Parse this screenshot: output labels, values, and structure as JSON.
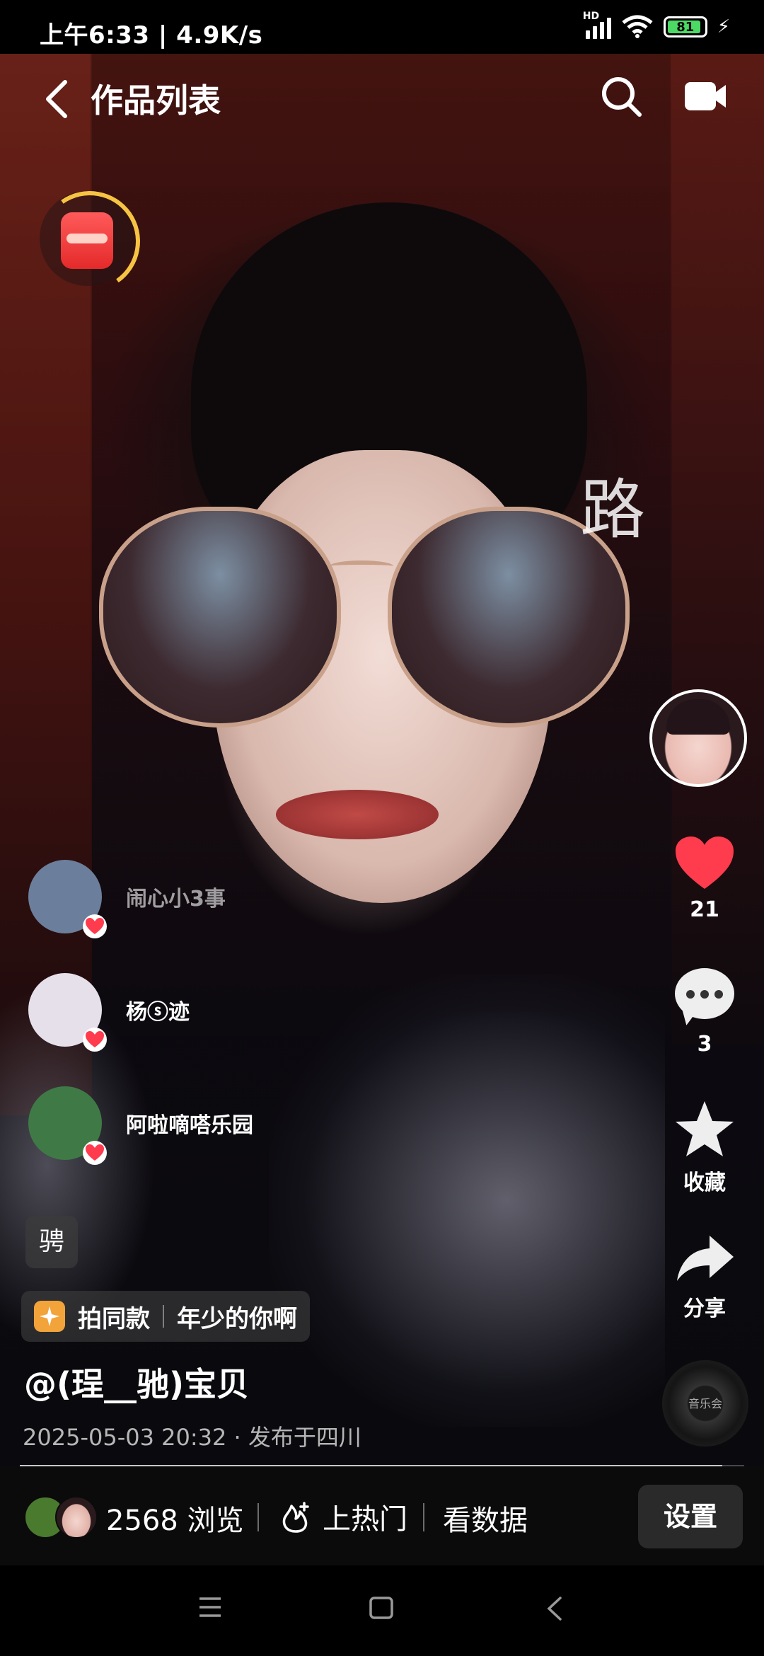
{
  "status": {
    "time_speed": "上午6:33 | 4.9K/s",
    "hd": "HD",
    "battery": "81"
  },
  "header": {
    "title": "作品列表"
  },
  "video": {
    "overlay_char": "路"
  },
  "likers": [
    {
      "name": "闹心小3事",
      "color": "#6b7f9c"
    },
    {
      "name": "杨ⓢ迹",
      "color": "#e6e0ea"
    },
    {
      "name": "阿啦嘀嗒乐园",
      "color": "#3f7a46"
    }
  ],
  "actions": {
    "like_count": "21",
    "comment_count": "3",
    "favorite_label": "收藏",
    "share_label": "分享"
  },
  "music_disc": {
    "label": "音乐会"
  },
  "post": {
    "tag_glyph": "骋",
    "same_label": "拍同款",
    "same_name": "年少的你啊",
    "author": "@(珵__驰)宝贝",
    "meta": "2025-05-03 20:32 · 发布于四川",
    "progress": 0.97
  },
  "bottom": {
    "views": "2568 浏览",
    "hot_label": "上热门",
    "data_label": "看数据",
    "settings_label": "设置"
  },
  "colors": {
    "like_red": "#ff3b4e",
    "battery_green": "#4cd964",
    "same_icon": "#f2a33a"
  }
}
